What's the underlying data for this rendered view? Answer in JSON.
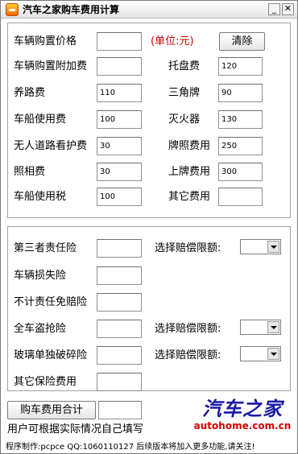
{
  "window": {
    "title": "汽车之家购车费用计算",
    "minimize_glyph": "_",
    "close_glyph": "✕"
  },
  "group1": {
    "price_label": "车辆购置价格",
    "price_value": "",
    "unit_label": "(单位:元)",
    "clear_button": "清除",
    "surcharge_label": "车辆购置附加费",
    "surcharge_value": "",
    "tray_label": "托盘费",
    "tray_value": "120",
    "road_label": "养路费",
    "road_value": "110",
    "triangle_label": "三角牌",
    "triangle_value": "90",
    "vehicle_use_label": "车船使用费",
    "vehicle_use_value": "100",
    "extinguisher_label": "灭火器",
    "extinguisher_value": "130",
    "unmanned_label": "无人道路看护费",
    "unmanned_value": "30",
    "plate_label": "牌照费用",
    "plate_value": "250",
    "photo_label": "照相费",
    "photo_value": "30",
    "plating_label": "上牌费用",
    "plating_value": "300",
    "vehicle_tax_label": "车船使用税",
    "vehicle_tax_value": "100",
    "other_label": "其它费用",
    "other_value": ""
  },
  "group2": {
    "third_party_label": "第三者责任险",
    "third_party_value": "",
    "limit_label_1": "选择赔偿限额:",
    "damage_label": "车辆损失险",
    "damage_value": "",
    "deductible_label": "不计责任免赔险",
    "deductible_value": "",
    "theft_label": "全车盗抢险",
    "theft_value": "",
    "limit_label_2": "选择赔偿限额:",
    "glass_label": "玻璃单独破碎险",
    "glass_value": "",
    "limit_label_3": "选择赔偿限额:",
    "other_ins_label": "其它保险费用",
    "other_ins_value": ""
  },
  "total": {
    "button": "购车费用合计",
    "value": ""
  },
  "note": "用户可根据实际情况自己填写",
  "footer": "程序制作:pcpce QQ:1060110127 后续版本将加入更多功能,请关注!",
  "brand": {
    "name": "汽车之家",
    "url": "autohome.com.cn"
  },
  "colors": {
    "unit_text": "#cc0000",
    "brand_blue": "#1a1aa6",
    "brand_red": "#d40000"
  }
}
